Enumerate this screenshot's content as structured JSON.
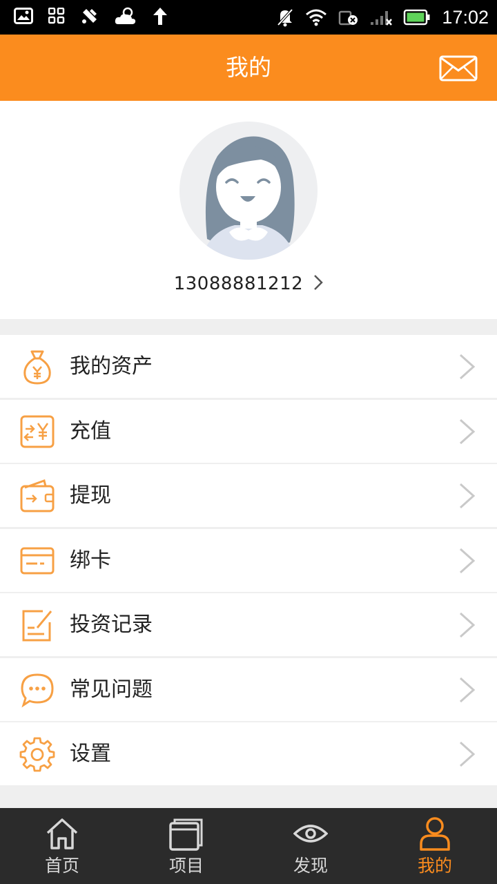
{
  "status_bar": {
    "time": "17:02",
    "left_icons": [
      "image-icon",
      "apps-icon",
      "tools-icon",
      "weather-icon",
      "upload-arrow-icon"
    ],
    "right_icons": [
      "mute-icon",
      "wifi-icon",
      "data-off-icon",
      "signal-icon",
      "battery-icon"
    ]
  },
  "header": {
    "title": "我的",
    "action_icon": "mail-icon"
  },
  "profile": {
    "phone": "13088881212"
  },
  "menu": {
    "items": [
      {
        "label": "我的资产",
        "icon": "money-bag-icon"
      },
      {
        "label": "充值",
        "icon": "recharge-icon"
      },
      {
        "label": "提现",
        "icon": "wallet-icon"
      },
      {
        "label": "绑卡",
        "icon": "bank-card-icon"
      },
      {
        "label": "投资记录",
        "icon": "edit-record-icon"
      },
      {
        "label": "常见问题",
        "icon": "chat-bubble-icon"
      },
      {
        "label": "设置",
        "icon": "gear-icon"
      }
    ]
  },
  "tabbar": {
    "tabs": [
      {
        "label": "首页",
        "icon": "home-icon"
      },
      {
        "label": "项目",
        "icon": "projects-icon"
      },
      {
        "label": "发现",
        "icon": "eye-icon"
      },
      {
        "label": "我的",
        "icon": "user-icon"
      }
    ],
    "active": "我的"
  },
  "colors": {
    "accent": "#fb8c1e",
    "status_bar_bg": "#000000",
    "tabbar_bg": "#2b2b2b",
    "page_bg": "#efefef"
  }
}
